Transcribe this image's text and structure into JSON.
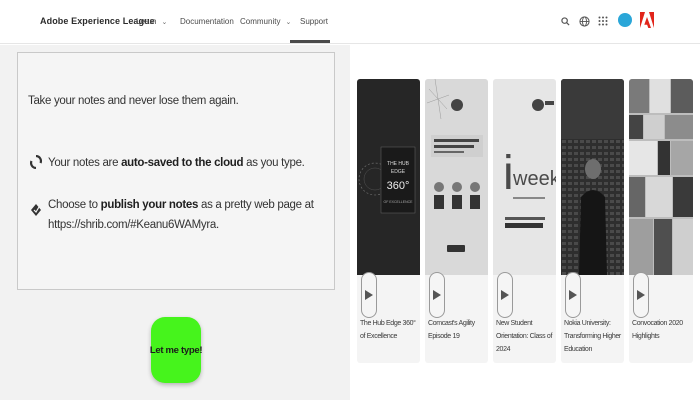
{
  "nav": {
    "brand": "Adobe Experience League",
    "learn": "Learn",
    "documentation": "Documentation",
    "community": "Community",
    "support": "Support",
    "chevron": "⌄"
  },
  "notes": {
    "headline": "Take your notes and never lose them again.",
    "feature1": {
      "before": "Your notes are ",
      "bold": "auto-saved to the cloud",
      "after": " as you type."
    },
    "feature2": {
      "before": "Choose to ",
      "bold": "publish your notes",
      "after": " as a pretty web page at https://shrib.com/#Keanu6WAMyra."
    },
    "cta": "Let me type!"
  },
  "videos": [
    {
      "title": "The Hub Edge 360° of Excellence"
    },
    {
      "title": "Comcast's Agility Episode 19"
    },
    {
      "title": "New Student Orientation: Class of 2024"
    },
    {
      "title": "Nokia University: Transforming Higher Education"
    },
    {
      "title": "Convocation 2020 Highlights"
    }
  ],
  "colors": {
    "accent_green": "#46f41c",
    "avatar_blue": "#2aa6d8",
    "adobe_red": "#e1251b"
  },
  "icons": [
    "search-icon",
    "globe-icon",
    "apps-grid-icon",
    "avatar",
    "adobe-logo",
    "sync-icon",
    "publish-icon",
    "play-icon"
  ]
}
